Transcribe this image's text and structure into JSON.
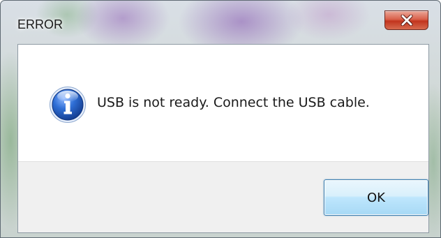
{
  "window": {
    "title": "ERROR",
    "close_icon": "close-x-icon"
  },
  "dialog": {
    "icon": "info-icon",
    "message": "USB is not ready. Connect the USB cable."
  },
  "buttons": {
    "ok_label": "OK"
  },
  "colors": {
    "close_button": "#c2351e",
    "ok_button_border": "#3c7fb1",
    "info_icon_blue": "#1a4fb0"
  }
}
